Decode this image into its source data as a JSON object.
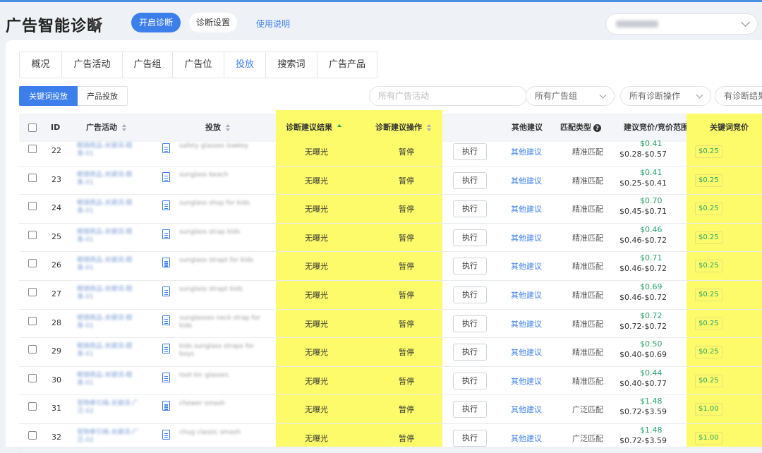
{
  "header": {
    "title": "广告智能诊断",
    "help_glyph": "?",
    "start_button": "开启诊断",
    "settings_button": "诊断设置",
    "help_link": "使用说明"
  },
  "tabs": [
    "概况",
    "广告活动",
    "广告组",
    "广告位",
    "投放",
    "搜索词",
    "广告产品"
  ],
  "active_tab": "投放",
  "subtabs": [
    "关键词投放",
    "产品投放"
  ],
  "filters": {
    "campaign_placeholder": "所有广告活动",
    "group": "所有广告组",
    "operation": "所有诊断操作",
    "result": "有诊断结果"
  },
  "columns": {
    "id": "ID",
    "campaign": "广告活动",
    "targeting": "投放",
    "diag_result": "诊断建议结果",
    "diag_action": "诊断建议操作",
    "other": "其他建议",
    "match_type": "匹配类型",
    "bid_range": "建议竞价/竞价范围",
    "keyword_bid": "关键词竞价"
  },
  "rows": [
    {
      "id": "22",
      "result": "无曝光",
      "action": "暂停",
      "exec": "执行",
      "other": "其他建议",
      "match": "精准匹配",
      "sugg": "$0.41",
      "range": "$0.28-$0.57",
      "bid": "$0.25",
      "campaign_blur": "眼镜商品-关键词-精准-01",
      "targeting_blur": "safety glasses lowkey"
    },
    {
      "id": "23",
      "result": "无曝光",
      "action": "暂停",
      "exec": "执行",
      "other": "其他建议",
      "match": "精准匹配",
      "sugg": "$0.41",
      "range": "$0.25-$0.41",
      "bid": "$0.25",
      "campaign_blur": "眼镜商品-关键词-精准-01",
      "targeting_blur": "sunglass beach"
    },
    {
      "id": "24",
      "result": "无曝光",
      "action": "暂停",
      "exec": "执行",
      "other": "其他建议",
      "match": "精准匹配",
      "sugg": "$0.70",
      "range": "$0.45-$0.71",
      "bid": "$0.25",
      "campaign_blur": "眼镜商品-关键词-精准-01",
      "targeting_blur": "sunglass shop for kids"
    },
    {
      "id": "25",
      "result": "无曝光",
      "action": "暂停",
      "exec": "执行",
      "other": "其他建议",
      "match": "精准匹配",
      "sugg": "$0.46",
      "range": "$0.46-$0.72",
      "bid": "$0.25",
      "campaign_blur": "眼镜商品-关键词-精准-01",
      "targeting_blur": "sunglass strap kids"
    },
    {
      "id": "26",
      "result": "无曝光",
      "action": "暂停",
      "exec": "执行",
      "other": "其他建议",
      "match": "精准匹配",
      "sugg": "$0.71",
      "range": "$0.46-$0.72",
      "bid": "$0.25",
      "campaign_blur": "眼镜商品-关键词-精准-01",
      "targeting_blur": "sunglass strapt for kids"
    },
    {
      "id": "27",
      "result": "无曝光",
      "action": "暂停",
      "exec": "执行",
      "other": "其他建议",
      "match": "精准匹配",
      "sugg": "$0.69",
      "range": "$0.46-$0.72",
      "bid": "$0.25",
      "campaign_blur": "眼镜商品-关键词-精准-01",
      "targeting_blur": "sunglass strapt kids"
    },
    {
      "id": "28",
      "result": "无曝光",
      "action": "暂停",
      "exec": "执行",
      "other": "其他建议",
      "match": "精准匹配",
      "sugg": "$0.72",
      "range": "$0.72-$0.72",
      "bid": "$0.25",
      "campaign_blur": "眼镜商品-关键词-精准-01",
      "targeting_blur": "sunglasses neck strap for kids"
    },
    {
      "id": "29",
      "result": "无曝光",
      "action": "暂停",
      "exec": "执行",
      "other": "其他建议",
      "match": "精准匹配",
      "sugg": "$0.50",
      "range": "$0.40-$0.69",
      "bid": "$0.25",
      "campaign_blur": "眼镜商品-关键词-精准-01",
      "targeting_blur": "kids sunglass straps for boys"
    },
    {
      "id": "30",
      "result": "无曝光",
      "action": "暂停",
      "exec": "执行",
      "other": "其他建议",
      "match": "精准匹配",
      "sugg": "$0.44",
      "range": "$0.40-$0.77",
      "bid": "$0.25",
      "campaign_blur": "眼镜商品-关键词-精准-01",
      "targeting_blur": "toot kic glasses"
    },
    {
      "id": "31",
      "result": "无曝光",
      "action": "暂停",
      "exec": "执行",
      "other": "其他建议",
      "match": "广泛匹配",
      "sugg": "$1.48",
      "range": "$0.72-$3.59",
      "bid": "$1.00",
      "campaign_blur": "宠物牵引绳-关键词-广泛-02",
      "targeting_blur": "chewer smash"
    },
    {
      "id": "32",
      "result": "无曝光",
      "action": "暂停",
      "exec": "执行",
      "other": "其他建议",
      "match": "广泛匹配",
      "sugg": "$1.48",
      "range": "$0.72-$3.59",
      "bid": "$1.00",
      "campaign_blur": "宠物牵引绳-关键词-广泛-02",
      "targeting_blur": "chug classic smash"
    }
  ]
}
